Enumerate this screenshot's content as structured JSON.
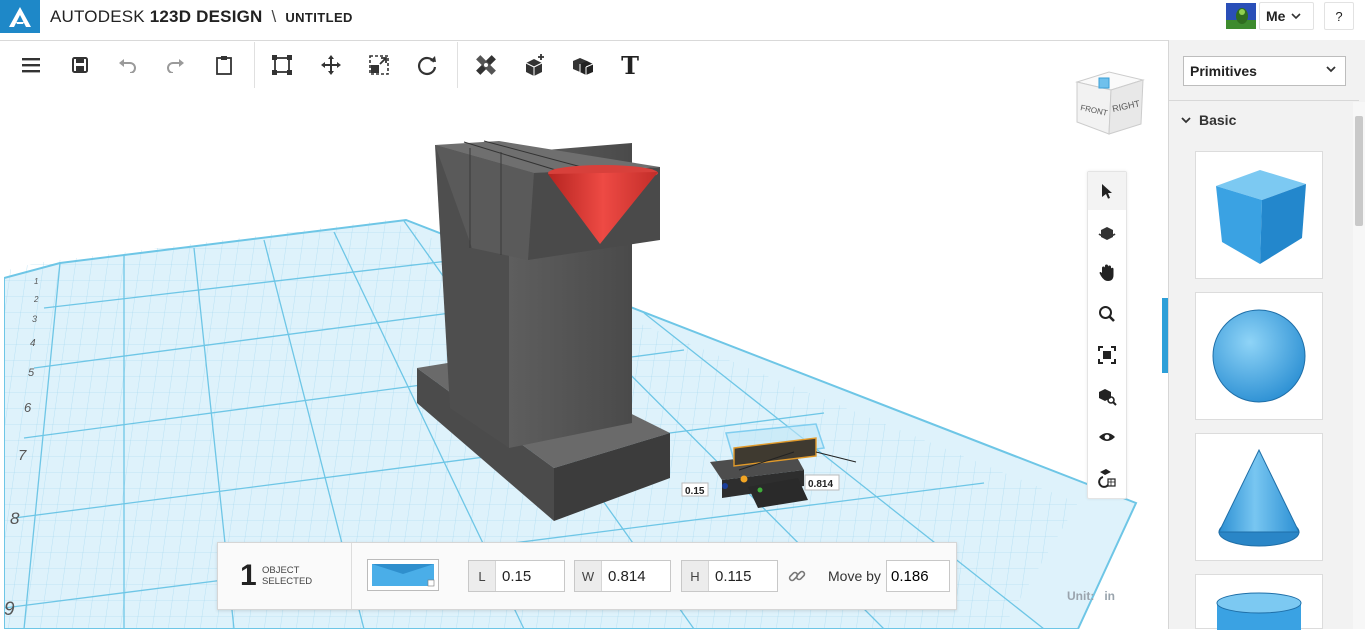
{
  "titlebar": {
    "brand_prefix": "AUTODESK",
    "brand_product": "123D",
    "brand_suffix": "DESIGN",
    "separator": "\\",
    "document_name": "UNTITLED",
    "user_label": "Me",
    "help_label": "?"
  },
  "toolbar": {
    "items": [
      {
        "icon": "menu-icon"
      },
      {
        "icon": "save-icon"
      },
      {
        "icon": "undo-icon"
      },
      {
        "icon": "redo-icon"
      },
      {
        "icon": "clipboard-icon"
      },
      {
        "icon": "smart-scale-icon"
      },
      {
        "icon": "move-icon"
      },
      {
        "icon": "scale-icon"
      },
      {
        "icon": "rotate-icon"
      },
      {
        "icon": "measure-icon"
      },
      {
        "icon": "snap-icon"
      },
      {
        "icon": "combine-icon"
      },
      {
        "icon": "text-icon",
        "label": "T"
      }
    ]
  },
  "viewcube": {
    "front_label": "FRONT",
    "right_label": "RIGHT"
  },
  "navbar": {
    "items": [
      "select-icon",
      "orbit-icon",
      "pan-icon",
      "zoom-icon",
      "fit-icon",
      "zoom-selected-icon",
      "visibility-icon",
      "material-icon"
    ]
  },
  "viewport": {
    "grid_ticks": [
      "1",
      "2",
      "3",
      "4",
      "5",
      "6",
      "7",
      "8",
      "9"
    ],
    "dimension_length": "0.15",
    "dimension_width": "0.814"
  },
  "selection": {
    "count": "1",
    "label_line1": "OBJECT",
    "label_line2": "SELECTED",
    "L_label": "L",
    "L_value": "0.15",
    "W_label": "W",
    "W_value": "0.814",
    "H_label": "H",
    "H_value": "0.115",
    "move_by_label": "Move by",
    "move_by_value": "0.186"
  },
  "units": {
    "label": "Unit:",
    "value": "in"
  },
  "right_panel": {
    "dropdown_value": "Primitives",
    "section_title": "Basic",
    "primitives": [
      "cube",
      "sphere",
      "cone",
      "cylinder"
    ]
  },
  "colors": {
    "accent": "#2d9fd8",
    "primitive_blue": "#4aaee8",
    "grid_line": "#7fcbe8",
    "grid_bg": "#d9f0fa",
    "model_gray": "#5a5a5a",
    "cone_red": "#e23a36"
  }
}
